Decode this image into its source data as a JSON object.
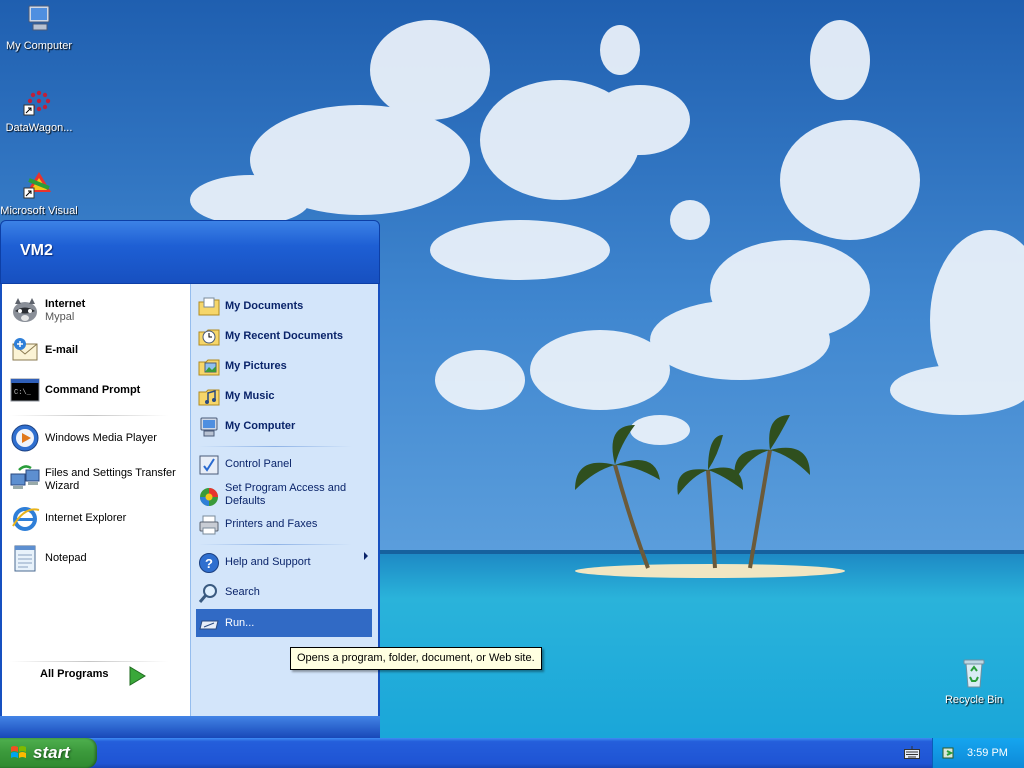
{
  "desktop": {
    "icons": [
      {
        "label": "My Computer",
        "icon": "my-computer-icon"
      },
      {
        "label": "DataWagon...",
        "icon": "datawagon-icon"
      },
      {
        "label": "Microsoft Visual",
        "icon": "visual-studio-icon"
      },
      {
        "label": "Recycle Bin",
        "icon": "recycle-bin-icon"
      }
    ]
  },
  "start_menu": {
    "user_name": "VM2",
    "pinned": [
      {
        "label": "Internet",
        "sublabel": "Mypal",
        "icon": "raccoon-browser-icon"
      },
      {
        "label": "E-mail",
        "sublabel": "",
        "icon": "email-icon"
      },
      {
        "label": "Command Prompt",
        "sublabel": "",
        "icon": "command-prompt-icon"
      }
    ],
    "recent": [
      {
        "label": "Windows Media Player",
        "icon": "media-player-icon"
      },
      {
        "label": "Files and Settings Transfer",
        "label2": "Wizard",
        "icon": "transfer-wizard-icon"
      },
      {
        "label": "Internet Explorer",
        "icon": "internet-explorer-icon"
      },
      {
        "label": "Notepad",
        "icon": "notepad-icon"
      }
    ],
    "all_programs": "All Programs",
    "places": [
      {
        "label": "My Documents",
        "icon": "folder-icon"
      },
      {
        "label": "My Recent Documents",
        "icon": "recent-docs-icon"
      },
      {
        "label": "My Pictures",
        "icon": "pictures-folder-icon"
      },
      {
        "label": "My Music",
        "icon": "music-folder-icon"
      },
      {
        "label": "My Computer",
        "icon": "my-computer-icon"
      }
    ],
    "settings": [
      {
        "label": "Control Panel",
        "icon": "control-panel-icon"
      },
      {
        "label": "Set Program Access and",
        "label2": "Defaults",
        "icon": "program-access-icon"
      },
      {
        "label": "Printers and Faxes",
        "icon": "printer-icon"
      }
    ],
    "system": [
      {
        "label": "Help and Support",
        "icon": "help-icon"
      },
      {
        "label": "Search",
        "icon": "search-icon"
      },
      {
        "label": "Run...",
        "icon": "run-icon"
      }
    ],
    "highlighted_item": "Run..."
  },
  "tooltip": "Opens a program, folder, document, or Web site.",
  "taskbar": {
    "start_label": "start",
    "clock": "3:59 PM"
  },
  "colors": {
    "start_green": "#3c9a3c",
    "taskbar_blue": "#245edb",
    "menu_header_blue": "#1e5fd4",
    "selection_blue": "#316ac5",
    "tray_blue": "#0e8ad8"
  }
}
